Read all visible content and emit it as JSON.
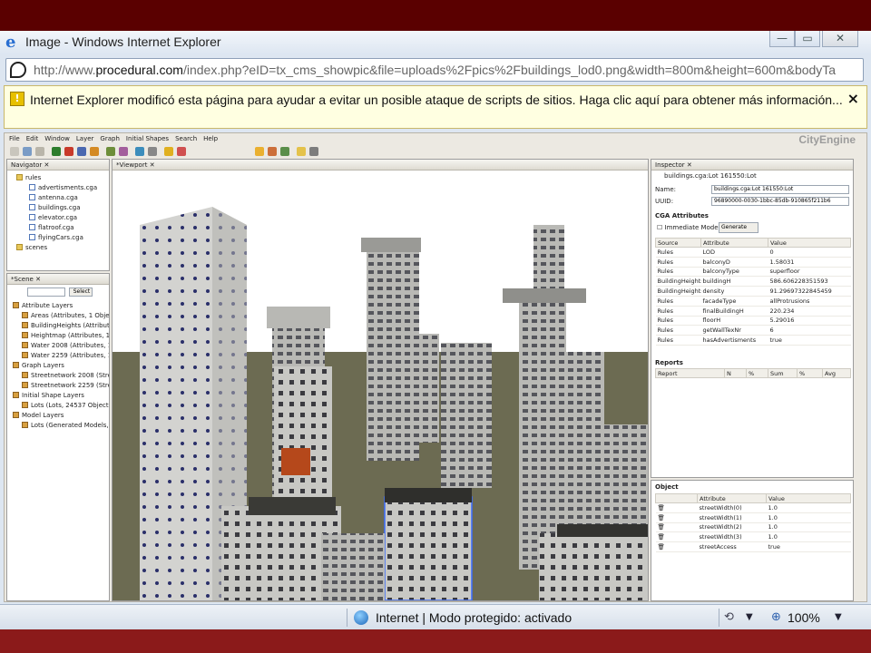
{
  "window": {
    "title": "Image - Windows Internet Explorer",
    "minimize": "—",
    "restore": "▭",
    "close": "✕"
  },
  "address": {
    "prefix": "http://www.",
    "domain": "procedural.com",
    "path": "/index.php?eID=tx_cms_showpic&file=uploads%2Fpics%2Fbuildings_lod0.png&width=800m&height=600m&bodyTa"
  },
  "infobar": {
    "text": "Internet Explorer modificó esta página para ayudar a evitar un posible ataque de scripts de sitios. Haga clic aquí para obtener más información...",
    "close": "×"
  },
  "cityengine": {
    "brand": "CityEngine",
    "menu": [
      "File",
      "Edit",
      "Window",
      "Layer",
      "Graph",
      "Initial Shapes",
      "Search",
      "Help"
    ],
    "navigator": {
      "title": "Navigator",
      "items": [
        {
          "type": "folder",
          "label": "rules"
        },
        {
          "type": "file",
          "label": "advertisments.cga"
        },
        {
          "type": "file",
          "label": "antenna.cga"
        },
        {
          "type": "file",
          "label": "buildings.cga"
        },
        {
          "type": "file",
          "label": "elevator.cga"
        },
        {
          "type": "file",
          "label": "flatroof.cga"
        },
        {
          "type": "file",
          "label": "flyingCars.cga"
        },
        {
          "type": "folder",
          "label": "scenes"
        }
      ]
    },
    "scene": {
      "title": "*Scene",
      "select_button": "Select",
      "items": [
        {
          "indent": 0,
          "label": "Attribute Layers"
        },
        {
          "indent": 1,
          "label": "Areas (Attributes, 1 Objec"
        },
        {
          "indent": 1,
          "label": "BuildingHeights (Attribute"
        },
        {
          "indent": 1,
          "label": "Heightmap (Attributes, 1"
        },
        {
          "indent": 1,
          "label": "Water 2008 (Attributes, 1"
        },
        {
          "indent": 1,
          "label": "Water 2259 (Attributes, 1"
        },
        {
          "indent": 0,
          "label": "Graph Layers"
        },
        {
          "indent": 1,
          "label": "Streetnetwork 2008 (Stre"
        },
        {
          "indent": 1,
          "label": "Streetnetwork 2259 (Stre"
        },
        {
          "indent": 0,
          "label": "Initial Shape Layers"
        },
        {
          "indent": 1,
          "label": "Lots (Lots, 24537 Objects"
        },
        {
          "indent": 0,
          "label": "Model Layers"
        },
        {
          "indent": 1,
          "label": "Lots (Generated Models,"
        }
      ]
    },
    "viewport": {
      "title": "*Viewport"
    },
    "inspector": {
      "title": "Inspector",
      "object_title": "buildings.cga:Lot  161550:Lot",
      "name_label": "Name:",
      "name_value": "buildings.cga:Lot  161550:Lot",
      "uuid_label": "UUID:",
      "uuid_value": "96890000-0030-1bbc-85db-910865f211b6",
      "cga_title": "CGA Attributes",
      "immediate_mode": "Immediate Mode",
      "generate": "Generate",
      "columns": [
        "Source",
        "Attribute",
        "Value"
      ],
      "rows": [
        [
          "Rules",
          "LOD",
          "0"
        ],
        [
          "Rules",
          "balconyD",
          "1.58031"
        ],
        [
          "Rules",
          "balconyType",
          "superfloor"
        ],
        [
          "BuildingHeights",
          "buildingH",
          "586.606228351593"
        ],
        [
          "BuildingHeights",
          "density",
          "91.29697322845459"
        ],
        [
          "Rules",
          "facadeType",
          "allProtrusions"
        ],
        [
          "Rules",
          "finalBuildingH",
          "220.234"
        ],
        [
          "Rules",
          "floorH",
          "5.29016"
        ],
        [
          "Rules",
          "getWallTexNr",
          "6"
        ],
        [
          "Rules",
          "hasAdvertisments",
          "true"
        ]
      ]
    },
    "reports": {
      "title": "Reports",
      "columns": [
        "Report",
        "N",
        "%",
        "Sum",
        "%",
        "Avg"
      ]
    },
    "object": {
      "title": "Object",
      "columns": [
        "",
        "Attribute",
        "Value"
      ],
      "rows": [
        [
          "streetWidth(0)",
          "1.0"
        ],
        [
          "streetWidth(1)",
          "1.0"
        ],
        [
          "streetWidth(2)",
          "1.0"
        ],
        [
          "streetWidth(3)",
          "1.0"
        ],
        [
          "streetAccess",
          "true"
        ]
      ]
    }
  },
  "status": {
    "zone": "Internet | Modo protegido: activado",
    "zoom": "100%"
  }
}
